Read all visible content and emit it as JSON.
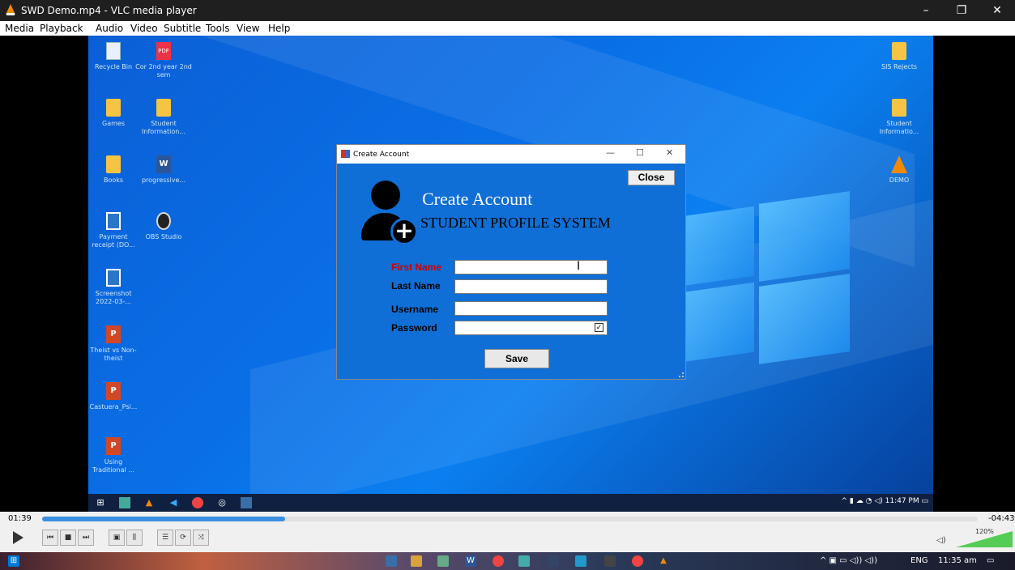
{
  "window": {
    "title": "SWD Demo.mp4 - VLC media player",
    "min": "–",
    "restore": "❐",
    "close": "✕"
  },
  "menu": [
    "Media",
    "Playback",
    "Audio",
    "Video",
    "Subtitle",
    "Tools",
    "View",
    "Help"
  ],
  "desktop": {
    "left_icons": [
      {
        "label": "Recycle Bin"
      },
      {
        "label": "Cor 2nd year 2nd sem",
        "badge": "PDF"
      },
      {
        "label": "Games"
      },
      {
        "label": "Student Information..."
      },
      {
        "label": "Books"
      },
      {
        "label": "progressive...",
        "badge": "W"
      },
      {
        "label": "Payment receipt (DO..."
      },
      {
        "label": "OBS Studio"
      },
      {
        "label": "Screenshot 2022-03-..."
      },
      {
        "label": "Theist vs Non-theist",
        "badge": "P"
      },
      {
        "label": "Castuera_Psi...",
        "badge": "P"
      },
      {
        "label": "Using Traditional ...",
        "badge": "P"
      }
    ],
    "right_icons": [
      {
        "label": "SIS Rejects"
      },
      {
        "label": "Student Informatio..."
      },
      {
        "label": "DEMO"
      }
    ]
  },
  "dialog": {
    "title": "Create Account",
    "min": "—",
    "max": "☐",
    "close": "✕",
    "close_button": "Close",
    "heading": "Create Account",
    "subheading": "STUDENT PROFILE SYSTEM",
    "plus": "+",
    "fields": [
      {
        "label": "First Name",
        "value": ""
      },
      {
        "label": "Last Name",
        "value": ""
      },
      {
        "label": "Username",
        "value": ""
      },
      {
        "label": "Password",
        "value": ""
      }
    ],
    "save_button": "Save",
    "colors": {
      "background": "#0f6fd6",
      "first_name_label": "#c00000"
    }
  },
  "video_taskbar": {
    "time": "11:47 PM"
  },
  "player": {
    "elapsed": "01:39",
    "remaining": "-04:43",
    "progress": 0.26,
    "volume": "120%"
  },
  "taskbar": {
    "lang": "ENG",
    "time": "11:35 am"
  }
}
